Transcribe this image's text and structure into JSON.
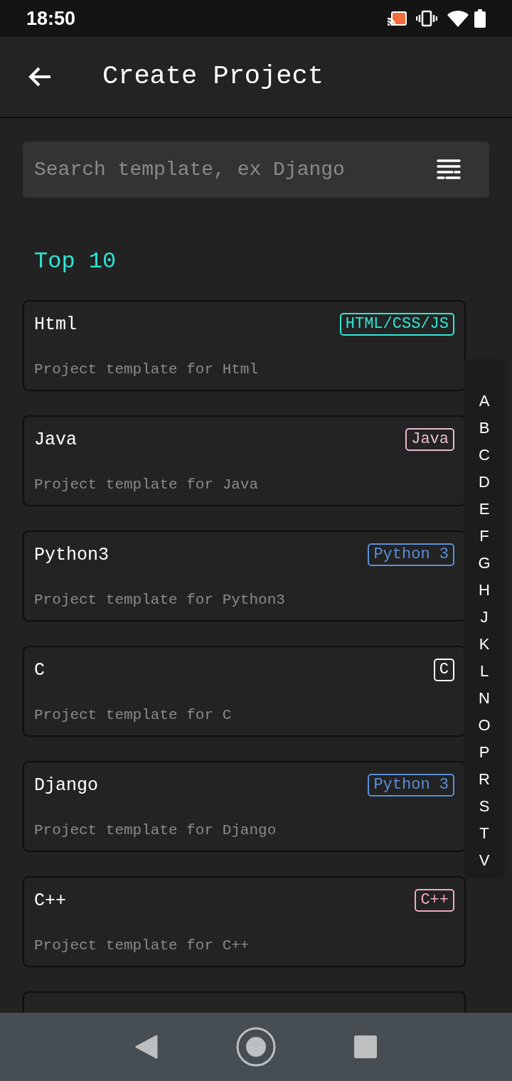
{
  "status_bar": {
    "time": "18:50"
  },
  "app_bar": {
    "title": "Create Project"
  },
  "search": {
    "placeholder": "Search template, ex Django"
  },
  "section": {
    "title": "Top 10"
  },
  "templates": [
    {
      "name": "Html",
      "description": "Project template for Html",
      "tag": "HTML/CSS/JS",
      "color": "#2ee6d6"
    },
    {
      "name": "Java",
      "description": "Project template for Java",
      "tag": "Java",
      "color": "#e6bcd2"
    },
    {
      "name": "Python3",
      "description": "Project template for Python3",
      "tag": "Python 3",
      "color": "#5b8fd6"
    },
    {
      "name": "C",
      "description": "Project template for C",
      "tag": "C",
      "color": "#ffffff"
    },
    {
      "name": "Django",
      "description": "Project template for Django",
      "tag": "Python 3",
      "color": "#5b8fd6"
    },
    {
      "name": "C++",
      "description": "Project template for C++",
      "tag": "C++",
      "color": "#f0a8c0"
    }
  ],
  "index_letters": [
    "A",
    "B",
    "C",
    "D",
    "E",
    "F",
    "G",
    "H",
    "J",
    "K",
    "L",
    "N",
    "O",
    "P",
    "R",
    "S",
    "T",
    "V"
  ]
}
